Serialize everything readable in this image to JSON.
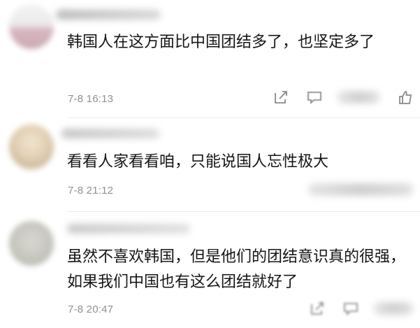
{
  "comments": [
    {
      "text": "韩国人在这方面比中国团结多了，也坚定多了",
      "time": "7-8 16:13",
      "actions": [
        "share-icon",
        "comment-icon",
        "like-icon"
      ]
    },
    {
      "text": "看看人家看看咱，只能说国人忘性极大",
      "time": "7-8 21:12",
      "actions": []
    },
    {
      "text": "虽然不喜欢韩国，但是他们的团结意识真的很强，如果我们中国也有这么团结就好了",
      "time": "7-8 20:47",
      "actions": [
        "share-icon",
        "comment-icon"
      ]
    }
  ]
}
